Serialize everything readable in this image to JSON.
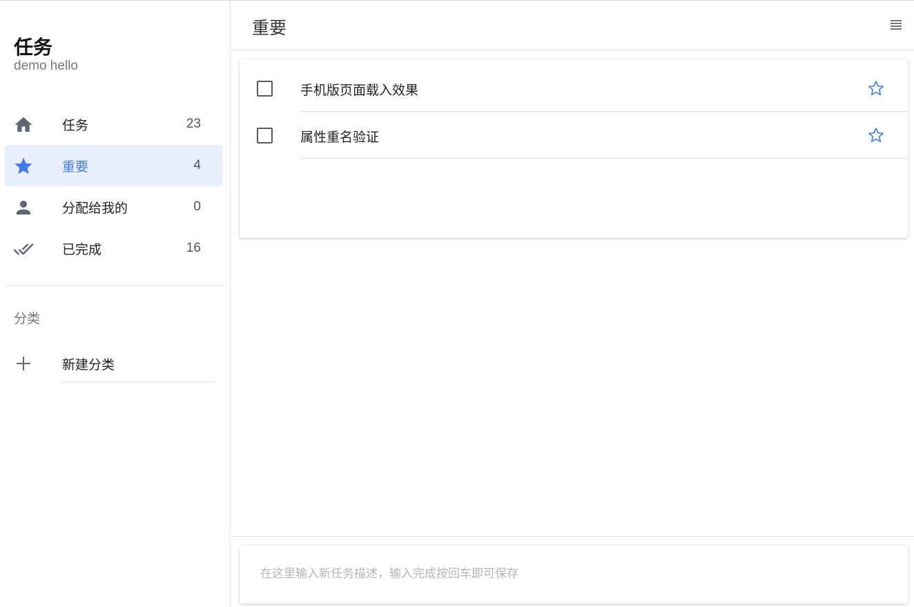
{
  "brand": {
    "title": "任务",
    "subtitle": "demo hello"
  },
  "nav": [
    {
      "label": "任务",
      "count": "23",
      "icon": "home-icon",
      "active": false
    },
    {
      "label": "重要",
      "count": "4",
      "icon": "star-icon",
      "active": true
    },
    {
      "label": "分配给我的",
      "count": "0",
      "icon": "person-icon",
      "active": false
    },
    {
      "label": "已完成",
      "count": "16",
      "icon": "done-all-icon",
      "active": false
    }
  ],
  "categories": {
    "title": "分类",
    "new_label": "新建分类"
  },
  "header": {
    "title": "重要"
  },
  "tasks": [
    {
      "name": "手机版页面载入效果",
      "starred": false
    },
    {
      "name": "属性重名验证",
      "starred": false
    }
  ],
  "new_task": {
    "placeholder": "在这里输入新任务描述，输入完成按回车即可保存",
    "value": ""
  },
  "colors": {
    "accent": "#3f7de8",
    "active_bg": "#e8eefc",
    "icon_gray": "#5f6673"
  }
}
